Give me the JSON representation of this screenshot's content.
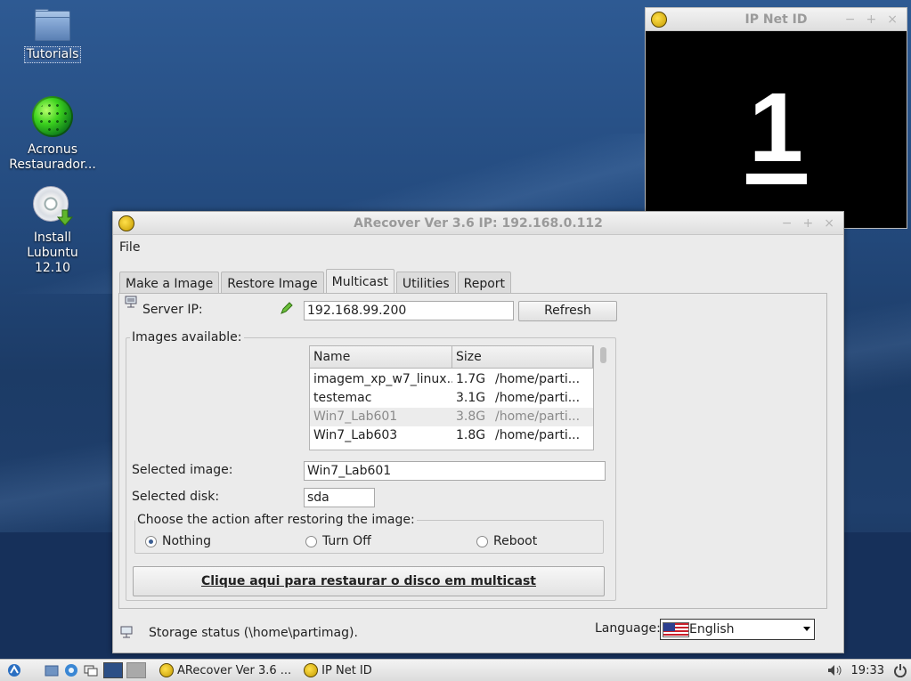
{
  "desktop": {
    "icons": [
      {
        "label": "Tutorials"
      },
      {
        "label": "Acronus Restaurador..."
      },
      {
        "label": "Install Lubuntu 12.10"
      }
    ]
  },
  "ipnet_window": {
    "title": "IP Net ID",
    "number": "1"
  },
  "arecover_window": {
    "title": "ARecover Ver 3.6 IP: 192.168.0.112",
    "menu": {
      "file": "File"
    },
    "tabs": [
      {
        "label": "Make a Image"
      },
      {
        "label": "Restore Image"
      },
      {
        "label": "Multicast",
        "active": true
      },
      {
        "label": "Utilities"
      },
      {
        "label": "Report"
      }
    ],
    "server_ip_label": "Server IP:",
    "server_ip_value": "192.168.99.200",
    "refresh_label": "Refresh",
    "images_group_label": "Images available:",
    "table": {
      "columns": [
        "Name",
        "Size"
      ],
      "rows": [
        {
          "name": "imagem_xp_w7_linux...",
          "size": "1.7G",
          "path": "/home/parti..."
        },
        {
          "name": "testemac",
          "size": "3.1G",
          "path": "/home/parti..."
        },
        {
          "name": "Win7_Lab601",
          "size": "3.8G",
          "path": "/home/parti...",
          "selected": true
        },
        {
          "name": "Win7_Lab603",
          "size": "1.8G",
          "path": "/home/parti..."
        }
      ]
    },
    "selected_image_label": "Selected image:",
    "selected_image_value": "Win7_Lab601",
    "selected_disk_label": "Selected disk:",
    "selected_disk_value": "sda",
    "action_group_label": "Choose the action after restoring the image:",
    "actions": [
      {
        "label": "Nothing",
        "checked": true
      },
      {
        "label": "Turn Off",
        "checked": false
      },
      {
        "label": "Reboot",
        "checked": false
      }
    ],
    "restore_button_label": "Clique aqui para restaurar o disco em multicast",
    "status_text": "Storage status (\\home\\partimag).",
    "language_label": "Language:",
    "language_value": "English"
  },
  "taskbar": {
    "tasks": [
      {
        "label": "ARecover Ver 3.6 ..."
      },
      {
        "label": "IP Net ID"
      }
    ],
    "clock": "19:33"
  },
  "colors": {
    "desktop_bg": "#244b7f",
    "window_bg": "#ebebeb",
    "radio_accent": "#3b5e92"
  }
}
